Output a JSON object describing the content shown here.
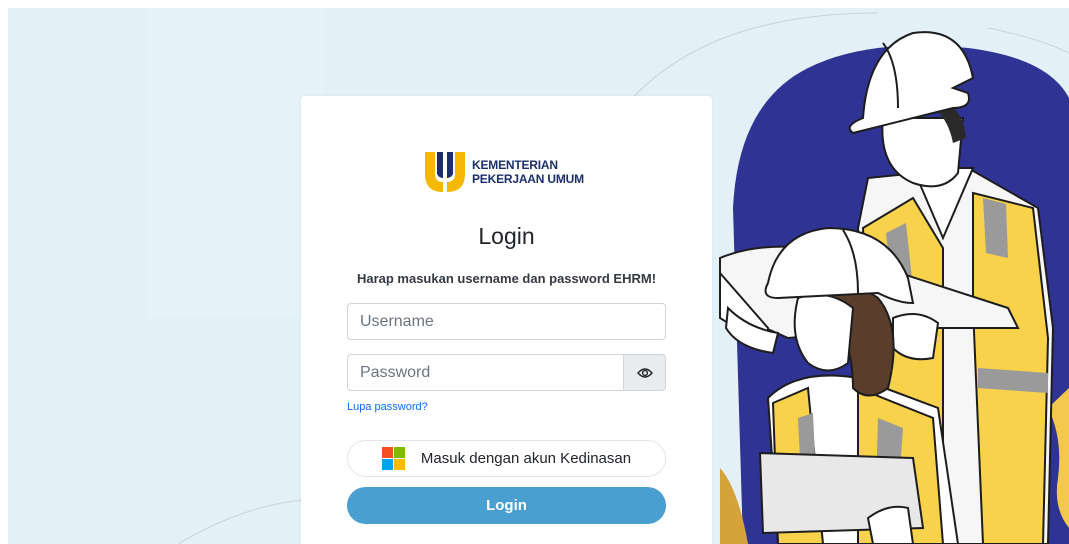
{
  "logo": {
    "line1": "KEMENTERIAN",
    "line2": "PEKERJAAN UMUM",
    "icon": "pu-logo-icon"
  },
  "login": {
    "title": "Login",
    "subtitle": "Harap masukan username dan password EHRM!",
    "username_placeholder": "Username",
    "username_value": "",
    "password_placeholder": "Password",
    "password_value": "",
    "toggle_icon": "eye-icon",
    "forgot_label": "Lupa password?",
    "sso_label": "Masuk dengan akun Kedinasan",
    "sso_icon": "microsoft-icon",
    "submit_label": "Login"
  },
  "colors": {
    "background": "#e3f0f8",
    "primary_button": "#4a9fd1",
    "link": "#0d6efd",
    "logo_yellow": "#f6b800",
    "logo_blue": "#1b2f6b",
    "illustration_blue": "#2f3393",
    "vest_yellow": "#f7d24a"
  }
}
